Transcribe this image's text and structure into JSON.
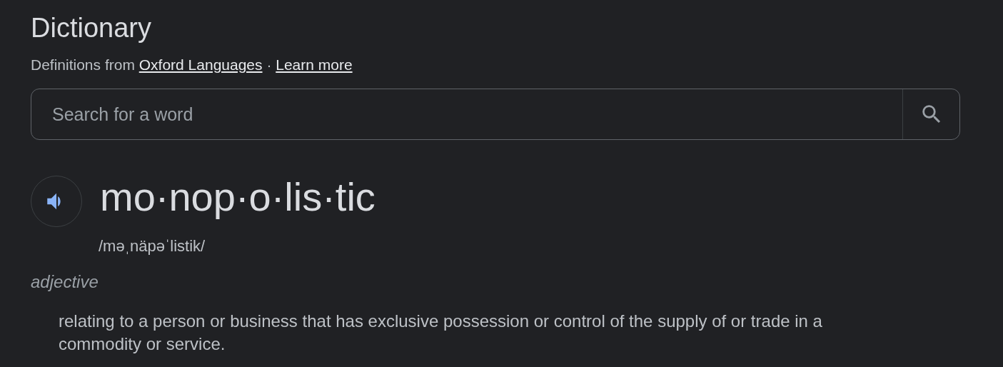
{
  "title": "Dictionary",
  "source": {
    "prefix": "Definitions from",
    "source_link": "Oxford Languages",
    "separator": "·",
    "learn_more": "Learn more"
  },
  "search": {
    "placeholder": "Search for a word"
  },
  "entry": {
    "word": "mo·nop·o·lis·tic",
    "pronunciation": "/məˌnäpəˈlistik/",
    "part_of_speech": "adjective",
    "definitions": [
      "relating to a person or business that has exclusive possession or control of the supply of or trade in a commodity or service."
    ]
  }
}
